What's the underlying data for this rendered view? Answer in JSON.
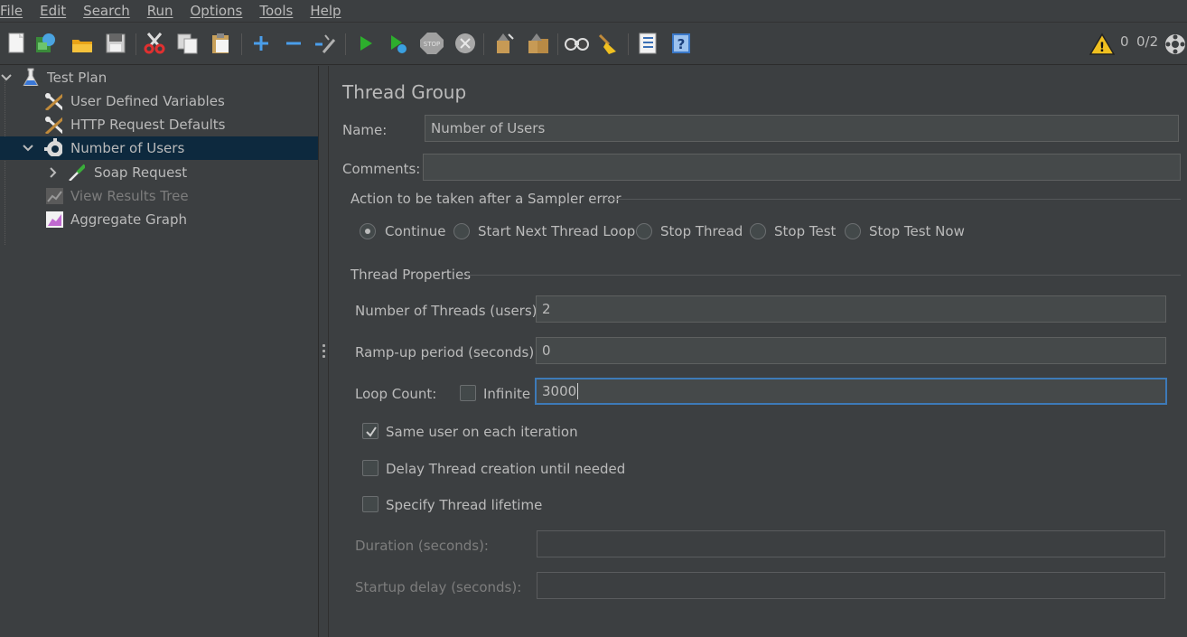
{
  "menu": [
    "File",
    "Edit",
    "Search",
    "Run",
    "Options",
    "Tools",
    "Help"
  ],
  "toolbar": {
    "icons": [
      "new-icon",
      "templates-icon",
      "open-icon",
      "save-icon",
      "cut-icon",
      "copy-icon",
      "paste-icon",
      "expand-icon",
      "collapse-icon",
      "toggle-icon",
      "start-icon",
      "start-no-pauses-icon",
      "stop-icon",
      "shutdown-icon",
      "clear-icon",
      "clear-all-icon",
      "search-icon",
      "reset-search-icon",
      "function-helper-icon",
      "help-icon"
    ],
    "warning_count": "0",
    "threads_status": "0/2"
  },
  "tree": {
    "items": [
      {
        "label": "Test Plan",
        "icon": "test-plan-icon"
      },
      {
        "label": "User Defined Variables",
        "icon": "config-element-icon"
      },
      {
        "label": "HTTP Request Defaults",
        "icon": "config-element-icon"
      },
      {
        "label": "Number of Users",
        "icon": "thread-group-gear-icon"
      },
      {
        "label": "Soap Request",
        "icon": "sampler-pipette-icon"
      },
      {
        "label": "View Results Tree",
        "icon": "listener-icon"
      },
      {
        "label": "Aggregate Graph",
        "icon": "graph-icon"
      }
    ]
  },
  "panel": {
    "title": "Thread Group",
    "name_label": "Name:",
    "name_value": "Number of Users",
    "comments_label": "Comments:",
    "comments_value": "",
    "sampler_error": {
      "title": "Action to be taken after a Sampler error",
      "options": [
        "Continue",
        "Start Next Thread Loop",
        "Stop Thread",
        "Stop Test",
        "Stop Test Now"
      ],
      "selected": "Continue"
    },
    "thread_properties": {
      "title": "Thread Properties",
      "threads_label": "Number of Threads (users):",
      "threads_value": "2",
      "rampup_label": "Ramp-up period (seconds):",
      "rampup_value": "0",
      "loop_label": "Loop Count:",
      "infinite_label": "Infinite",
      "infinite_checked": false,
      "loop_value": "3000",
      "same_user_label": "Same user on each iteration",
      "same_user_checked": true,
      "delay_label": "Delay Thread creation until needed",
      "delay_checked": false,
      "lifetime_label": "Specify Thread lifetime",
      "lifetime_checked": false,
      "duration_label": "Duration (seconds):",
      "duration_value": "",
      "startup_label": "Startup delay (seconds):",
      "startup_value": ""
    }
  }
}
